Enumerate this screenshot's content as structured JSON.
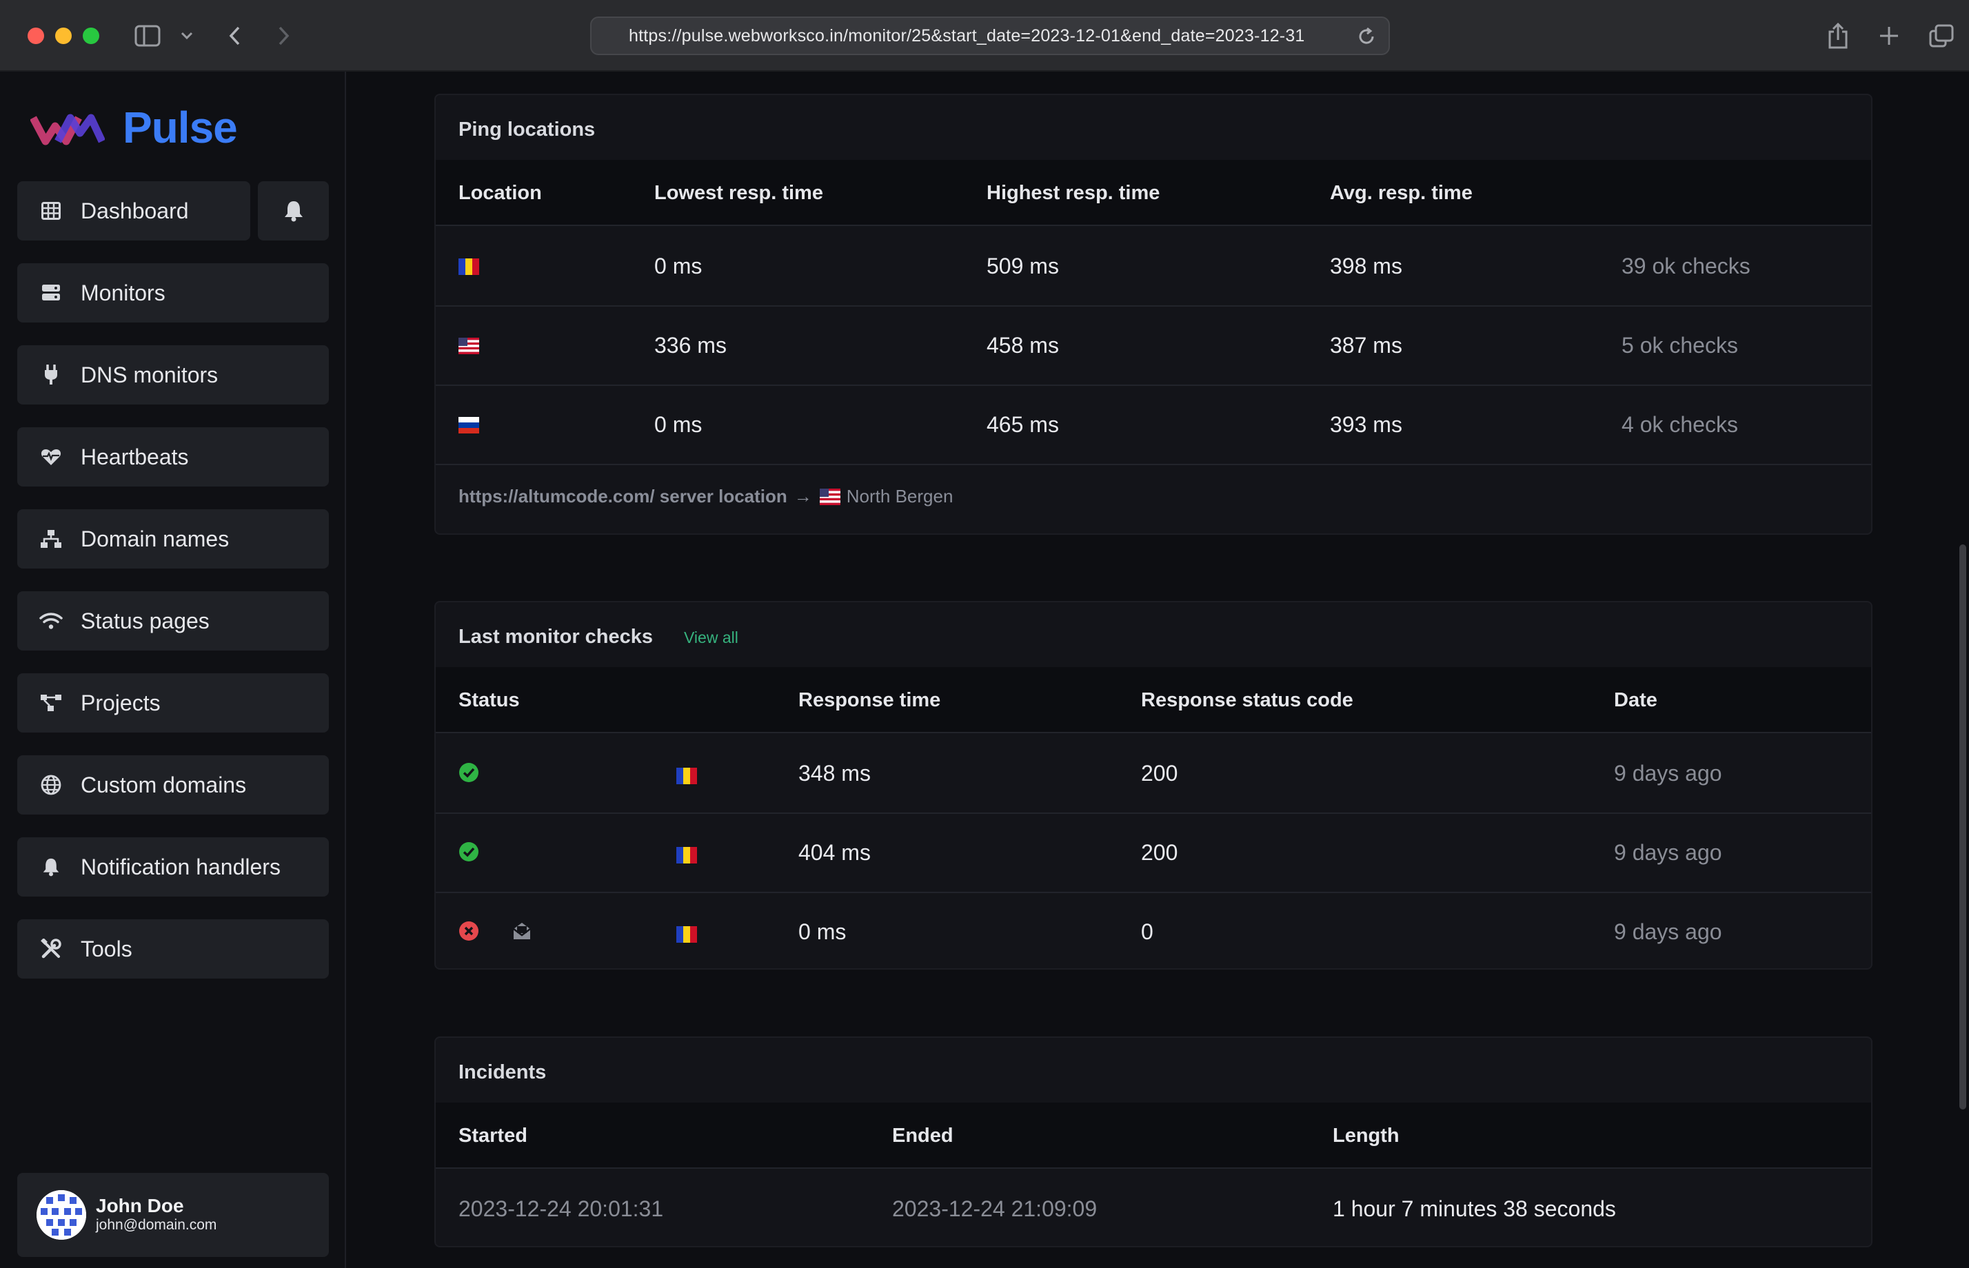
{
  "browser": {
    "url": "https://pulse.webworksco.in/monitor/25&start_date=2023-12-01&end_date=2023-12-31"
  },
  "sidebar": {
    "brand": "Pulse",
    "items": [
      {
        "label": "Dashboard",
        "icon": "table-icon"
      },
      {
        "label": "Monitors",
        "icon": "server-icon"
      },
      {
        "label": "DNS monitors",
        "icon": "plug-icon"
      },
      {
        "label": "Heartbeats",
        "icon": "heart-pulse-icon"
      },
      {
        "label": "Domain names",
        "icon": "network-icon"
      },
      {
        "label": "Status pages",
        "icon": "wifi-icon"
      },
      {
        "label": "Projects",
        "icon": "project-diagram-icon"
      },
      {
        "label": "Custom domains",
        "icon": "globe-icon"
      },
      {
        "label": "Notification handlers",
        "icon": "bell-icon"
      },
      {
        "label": "Tools",
        "icon": "tools-icon"
      }
    ],
    "user": {
      "name": "John Doe",
      "email": "john@domain.com"
    }
  },
  "ping_locations": {
    "title": "Ping locations",
    "columns": [
      "Location",
      "Lowest resp. time",
      "Highest resp. time",
      "Avg. resp. time"
    ],
    "rows": [
      {
        "flag": "Romania",
        "lowest": "0 ms",
        "highest": "509 ms",
        "avg": "398 ms",
        "checks": "39 ok checks"
      },
      {
        "flag": "United States",
        "lowest": "336 ms",
        "highest": "458 ms",
        "avg": "387 ms",
        "checks": "5 ok checks"
      },
      {
        "flag": "Russia",
        "lowest": "0 ms",
        "highest": "465 ms",
        "avg": "393 ms",
        "checks": "4 ok checks"
      }
    ],
    "server_location": {
      "link": "https://altumcode.com/ server location",
      "arrow": "→",
      "city": "North Bergen"
    }
  },
  "last_checks": {
    "title": "Last monitor checks",
    "view_all": "View all",
    "columns": [
      "Status",
      "Response time",
      "Response status code",
      "Date"
    ],
    "rows": [
      {
        "status": "ok",
        "response_time": "348 ms",
        "code": "200",
        "date": "9 days ago"
      },
      {
        "status": "ok",
        "response_time": "404 ms",
        "code": "200",
        "date": "9 days ago"
      },
      {
        "status": "error",
        "response_time": "0 ms",
        "code": "0",
        "date": "9 days ago"
      }
    ]
  },
  "incidents": {
    "title": "Incidents",
    "columns": [
      "Started",
      "Ended",
      "Length"
    ],
    "rows": [
      {
        "started": "2023-12-24 20:01:31",
        "ended": "2023-12-24 21:09:09",
        "length": "1 hour 7 minutes 38 seconds"
      }
    ]
  },
  "colors": {
    "accent": "#3b7cf6",
    "ok": "#2fb344",
    "error": "#e5484d",
    "link_green": "#36b37e"
  }
}
